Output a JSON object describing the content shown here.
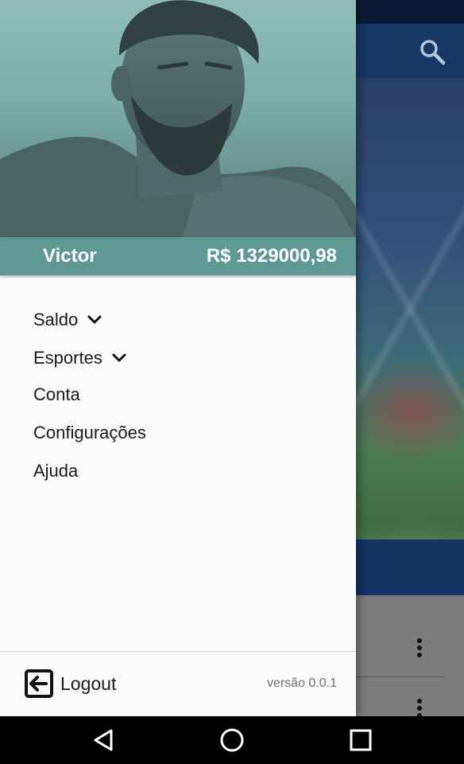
{
  "drawer": {
    "user_name": "Victor",
    "balance": "R$ 1329000,98",
    "menu": [
      {
        "label": "Saldo",
        "expandable": true,
        "icon": "chevron-down-icon"
      },
      {
        "label": "Esportes",
        "expandable": true,
        "icon": "chevron-down-icon"
      },
      {
        "label": "Conta",
        "expandable": false
      },
      {
        "label": "Configurações",
        "expandable": false
      },
      {
        "label": "Ajuda",
        "expandable": false
      }
    ],
    "logout_label": "Logout",
    "logout_icon": "logout-icon",
    "version": "versão 0.0.1",
    "accent_color": "#5e9993"
  },
  "background": {
    "appbar_color": "#163868",
    "search_icon": "search-icon",
    "more_icon": "more-vertical-icon"
  },
  "navbar": {
    "back_icon": "back-triangle-icon",
    "home_icon": "home-circle-icon",
    "recents_icon": "recents-square-icon"
  }
}
